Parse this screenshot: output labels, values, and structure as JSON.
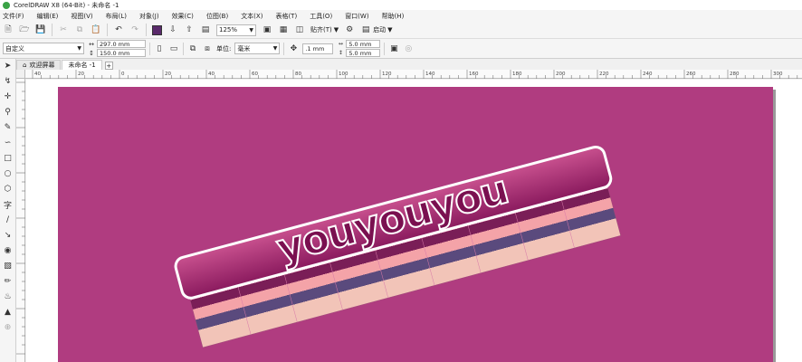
{
  "window": {
    "title": "CorelDRAW X8 (64-Bit) - 未命名 -1"
  },
  "menu": [
    "文件(F)",
    "编辑(E)",
    "视图(V)",
    "布局(L)",
    "对象(J)",
    "效果(C)",
    "位图(B)",
    "文本(X)",
    "表格(T)",
    "工具(O)",
    "窗口(W)",
    "帮助(H)"
  ],
  "toolbar": {
    "zoom": "125%",
    "snap_label": "贴齐(T)",
    "launch_label": "启动"
  },
  "property_bar": {
    "page_preset": "自定义",
    "width": "297.0 mm",
    "height": "150.0 mm",
    "units_label": "单位:",
    "units_value": "毫米",
    "nudge": ".1 mm",
    "dup_x": "5.0 mm",
    "dup_y": "5.0 mm"
  },
  "tabs": [
    {
      "label": "欢迎屏幕"
    },
    {
      "label": "未命名 -1"
    }
  ],
  "ruler": {
    "h_ticks": [
      "40",
      "20",
      "0",
      "20",
      "40",
      "60",
      "80",
      "100",
      "120",
      "140",
      "160",
      "180",
      "200",
      "220",
      "240",
      "260",
      "280",
      "300"
    ]
  },
  "artwork": {
    "text": "youyouyou",
    "page_color": "#b03c80",
    "face_color": "#8a1a5e",
    "stripe_colors": [
      "#f09ab8",
      "#7a1e57",
      "#f4a3a8",
      "#5a4a7d",
      "#f2c4b8"
    ]
  }
}
